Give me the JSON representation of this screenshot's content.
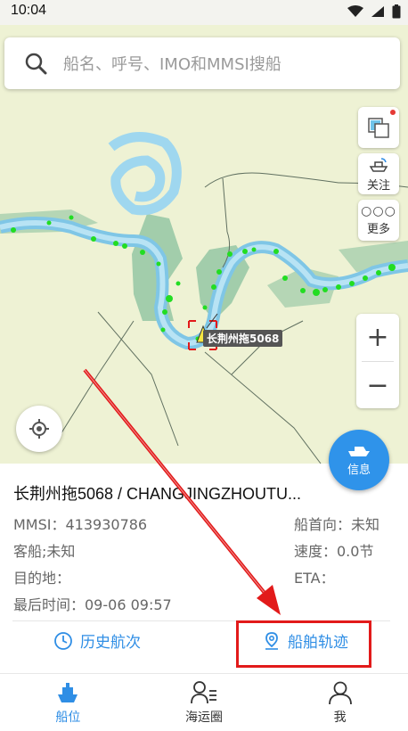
{
  "status": {
    "time": "10:04"
  },
  "search": {
    "placeholder": "船名、呼号、IMO和MMSI搜船"
  },
  "map_controls": {
    "follow_label": "关注",
    "more_label": "更多",
    "zoom_in": "+",
    "zoom_out": "−",
    "info_label": "信息"
  },
  "map": {
    "ship_label": "长荆州拖5068"
  },
  "ship": {
    "title": "长荆州拖5068 / CHANGJINGZHOUTU...",
    "mmsi": "MMSI：413930786",
    "type": "客船;未知",
    "destination": "目的地：",
    "last_time": "最后时间：09-06 09:57",
    "heading": "船首向：未知",
    "speed": "速度：0.0节",
    "eta": "ETA："
  },
  "actions": {
    "history": "历史航次",
    "track": "船舶轨迹"
  },
  "tabs": [
    {
      "label": "船位"
    },
    {
      "label": "海运圈"
    },
    {
      "label": "我"
    }
  ],
  "colors": {
    "accent": "#2f8ee5",
    "highlight": "#e21a1a"
  }
}
